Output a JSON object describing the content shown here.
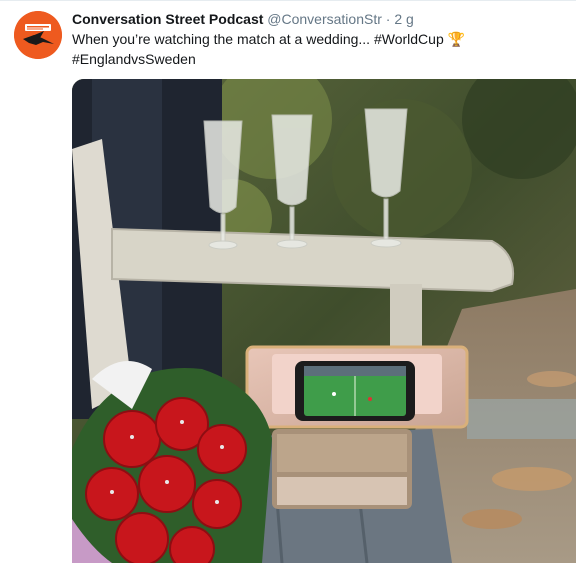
{
  "tweet": {
    "display_name": "Conversation Street Podcast",
    "handle": "@ConversationStr",
    "separator": "·",
    "time": "2 g",
    "text": "When you’re watching the match at a wedding... ",
    "hashtag_1": "#WorldCup",
    "emoji": "🏆",
    "hashtag_2": "#EnglandvsSweden"
  },
  "colors": {
    "avatar_bg": "#ee5a1f",
    "text": "#14171a",
    "meta": "#657786"
  }
}
